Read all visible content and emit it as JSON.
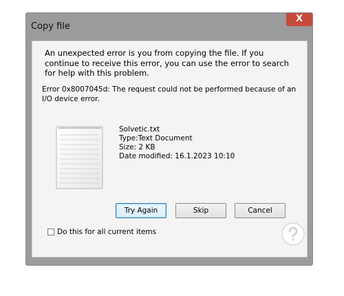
{
  "window": {
    "title": "Copy file",
    "close_label": "X"
  },
  "message": {
    "main": "An unexpected error is you from copying the file. If you continue to receive this error, you can use the error to search for help with this problem.",
    "error": "Error 0x8007045d: The request could not be performed because of an I/O device error."
  },
  "file": {
    "name": "Solvetic.txt",
    "type": "Type:Text Document",
    "size": "Size: 2 KB",
    "modified": "Date modified: 16.1.2023 10:10"
  },
  "buttons": {
    "try_again": "Try Again",
    "skip": "Skip",
    "cancel": "Cancel"
  },
  "checkbox": {
    "label": "Do this for all current items",
    "checked": false
  },
  "colors": {
    "close_button": "#c64a3c",
    "frame": "#9b9b9b",
    "accent": "#3c7fb1"
  },
  "icons": {
    "file": "text-document-icon",
    "watermark": "question-logo-icon"
  }
}
